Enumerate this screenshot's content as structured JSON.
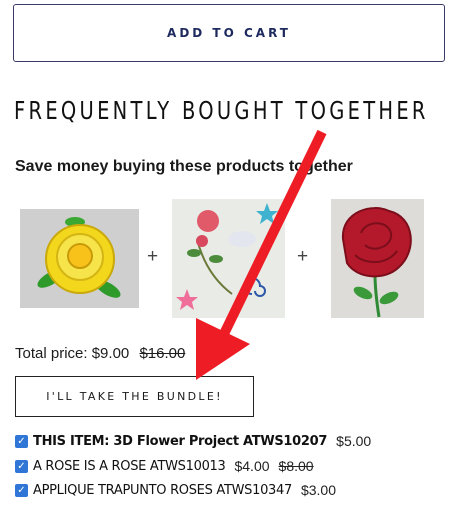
{
  "add_to_cart": {
    "label": "ADD TO CART"
  },
  "fbt": {
    "title": "FREQUENTLY BOUGHT TOGETHER",
    "subtitle": "Save money buying these products together",
    "plus_sign": "+",
    "total_label": "Total price:",
    "total_price": "$9.00",
    "total_original": "$16.00",
    "bundle_button": "I'LL TAKE THE BUNDLE!",
    "items": [
      {
        "name": "THIS ITEM: 3D Flower Project ATWS10207",
        "price": "$5.00",
        "original_price": "",
        "checked": true
      },
      {
        "name": "A ROSE IS A ROSE ATWS10013",
        "price": "$4.00",
        "original_price": "$8.00",
        "checked": true
      },
      {
        "name": "APPLIQUE TRAPUNTO ROSES ATWS10347",
        "price": "$3.00",
        "original_price": "",
        "checked": true
      }
    ]
  },
  "annotation": {
    "color": "#ee1c24"
  },
  "icons": {
    "checkbox": "checkmark-icon",
    "annotation": "red-arrow-icon"
  }
}
